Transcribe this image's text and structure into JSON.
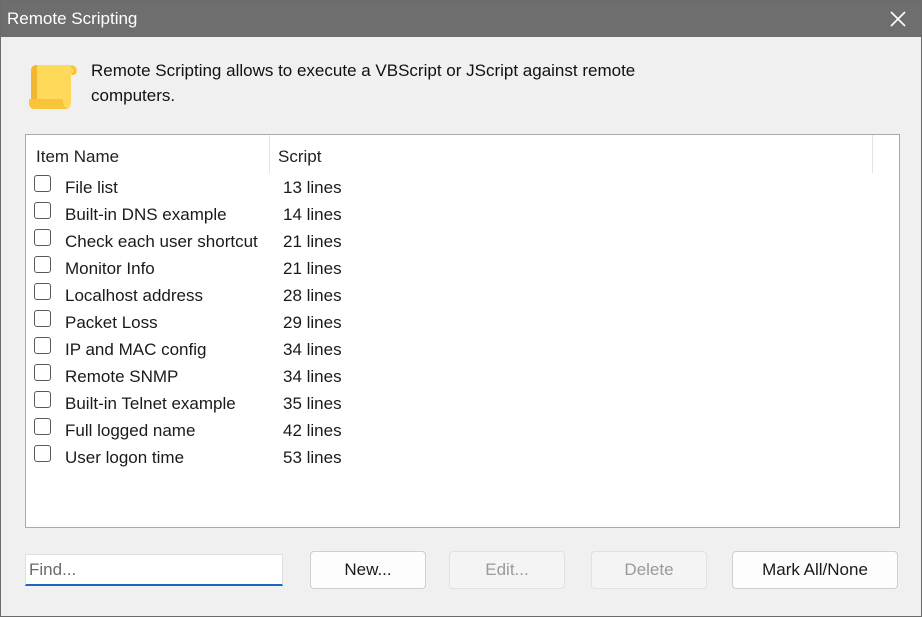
{
  "window": {
    "title": "Remote Scripting",
    "close_icon": "close-icon"
  },
  "header": {
    "icon": "scroll-icon",
    "description": "Remote Scripting allows to execute a VBScript or JScript against remote computers."
  },
  "list": {
    "columns": {
      "name": "Item Name",
      "script": "Script"
    },
    "items": [
      {
        "name": "File list",
        "script": "13 lines",
        "checked": false
      },
      {
        "name": "Built-in DNS example",
        "script": "14 lines",
        "checked": false
      },
      {
        "name": "Check each user shortcut",
        "script": "21 lines",
        "checked": false
      },
      {
        "name": "Monitor Info",
        "script": "21 lines",
        "checked": false
      },
      {
        "name": "Localhost address",
        "script": "28 lines",
        "checked": false
      },
      {
        "name": "Packet Loss",
        "script": "29 lines",
        "checked": false
      },
      {
        "name": "IP and MAC config",
        "script": "34 lines",
        "checked": false
      },
      {
        "name": "Remote SNMP",
        "script": "34 lines",
        "checked": false
      },
      {
        "name": "Built-in Telnet example",
        "script": "35 lines",
        "checked": false
      },
      {
        "name": "Full logged name",
        "script": "42 lines",
        "checked": false
      },
      {
        "name": "User logon time",
        "script": "53 lines",
        "checked": false
      }
    ]
  },
  "footer": {
    "find_placeholder": "Find...",
    "find_value": "",
    "new_label": "New...",
    "edit_label": "Edit...",
    "delete_label": "Delete",
    "mark_label": "Mark All/None"
  },
  "colors": {
    "titlebar": "#6e6e6e",
    "accent": "#1c67c4",
    "icon_yellow": "#ffd95a"
  }
}
